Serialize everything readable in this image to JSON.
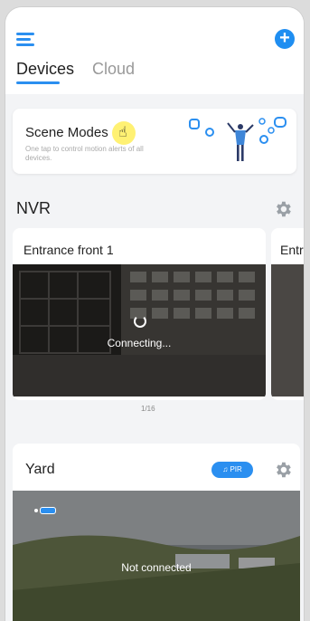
{
  "tabs": {
    "devices": "Devices",
    "cloud": "Cloud"
  },
  "scene": {
    "title": "Scene Modes",
    "subtitle": "One tap to control motion alerts of all devices."
  },
  "nvr": {
    "title": "NVR",
    "camera_name": "Entrance front 1",
    "next_camera_name": "Entra",
    "status": "Connecting...",
    "page_indicator": "1/16"
  },
  "yard": {
    "title": "Yard",
    "badge": "PIR",
    "status": "Not connected"
  },
  "colors": {
    "accent": "#2b8ff0",
    "background": "#f3f4f6",
    "card": "#ffffff"
  },
  "icons": [
    "menu-icon",
    "add-icon",
    "hand-cursor-icon",
    "gear-icon",
    "bell-icon",
    "battery-icon"
  ]
}
